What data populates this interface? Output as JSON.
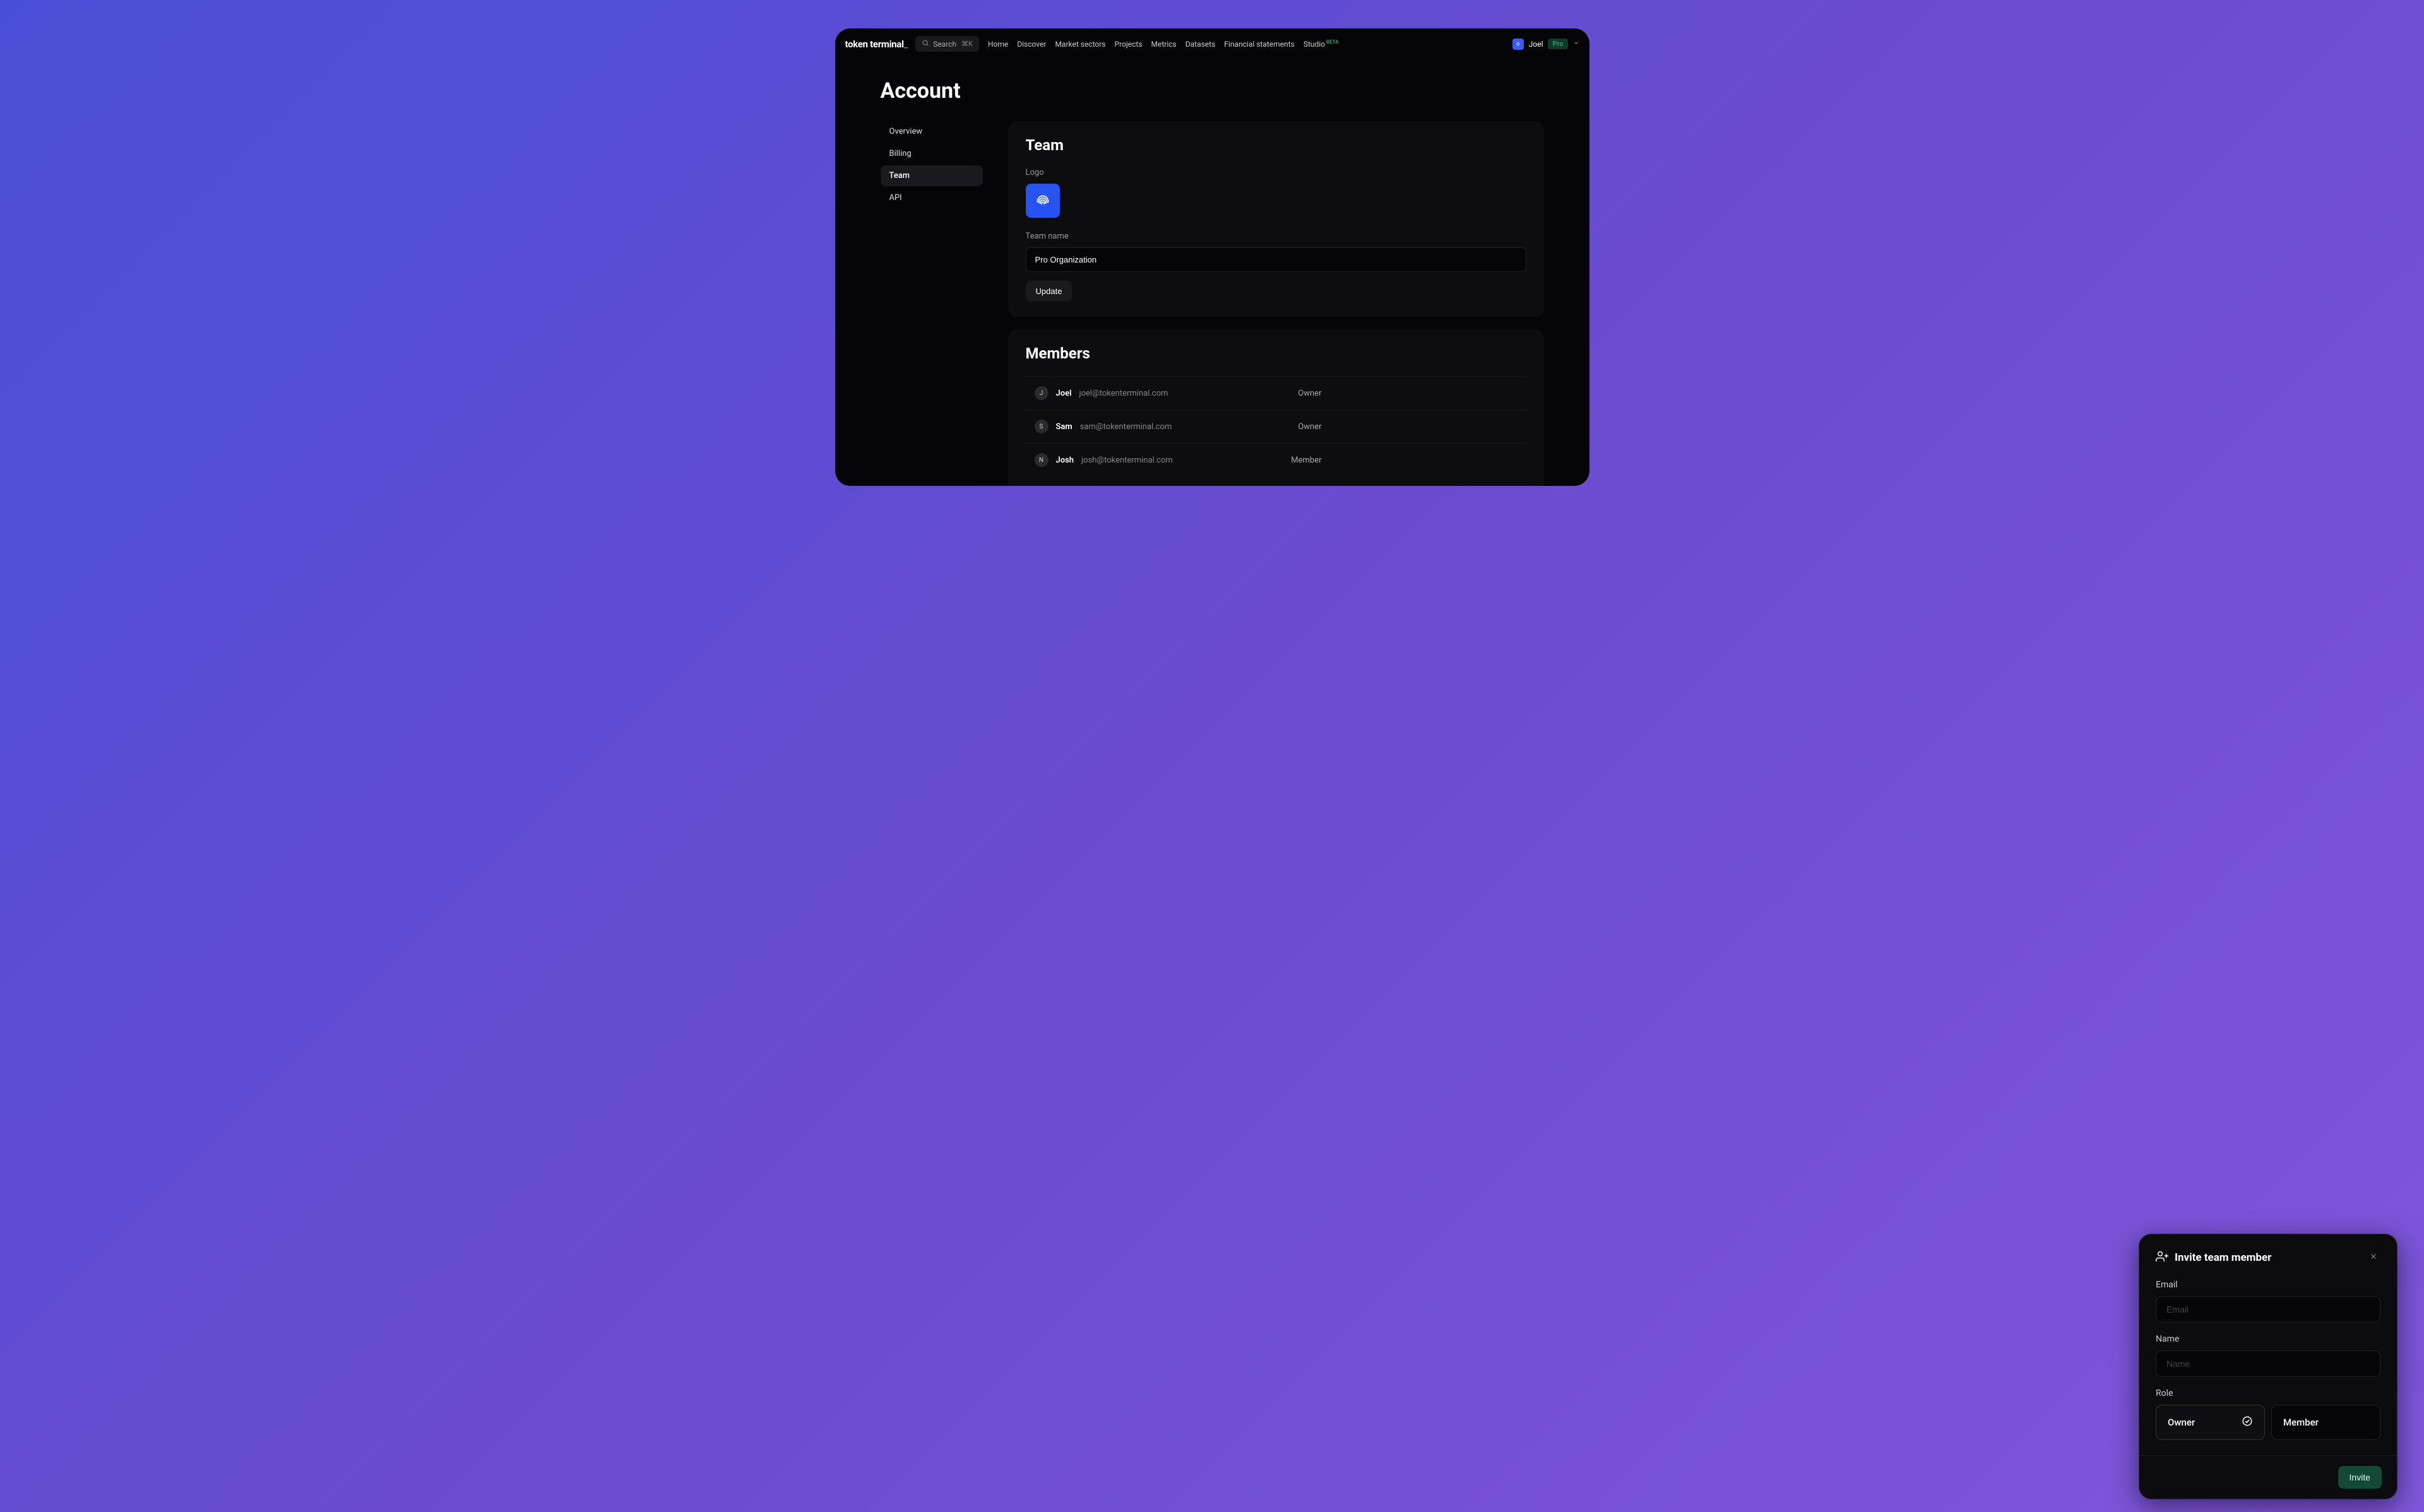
{
  "brand": {
    "name": "token terminal",
    "cursor": "_"
  },
  "search": {
    "placeholder": "Search",
    "shortcut": "⌘K"
  },
  "nav": {
    "items": [
      {
        "label": "Home"
      },
      {
        "label": "Discover"
      },
      {
        "label": "Market sectors"
      },
      {
        "label": "Projects"
      },
      {
        "label": "Metrics"
      },
      {
        "label": "Datasets"
      },
      {
        "label": "Financial statements"
      },
      {
        "label": "Studio",
        "badge": "BETA"
      }
    ]
  },
  "user": {
    "name": "Joel",
    "avatar_letter": "o",
    "plan": "Pro"
  },
  "page": {
    "title": "Account"
  },
  "sidebar": {
    "items": [
      {
        "label": "Overview"
      },
      {
        "label": "Billing"
      },
      {
        "label": "Team"
      },
      {
        "label": "API"
      }
    ]
  },
  "team_card": {
    "title": "Team",
    "logo_label": "Logo",
    "name_label": "Team name",
    "name_value": "Pro Organization",
    "update_label": "Update"
  },
  "members_card": {
    "title": "Members",
    "rows": [
      {
        "initial": "J",
        "name": "Joel",
        "email": "joel@tokenterminal.com",
        "role": "Owner"
      },
      {
        "initial": "S",
        "name": "Sam",
        "email": "sam@tokenterminal.com",
        "role": "Owner"
      },
      {
        "initial": "N",
        "name": "Josh",
        "email": "josh@tokenterminal.com",
        "role": "Member"
      }
    ]
  },
  "invite_modal": {
    "title": "Invite team member",
    "email_label": "Email",
    "email_placeholder": "Email",
    "name_label": "Name",
    "name_placeholder": "Name",
    "role_label": "Role",
    "roles": [
      {
        "label": "Owner",
        "selected": true
      },
      {
        "label": "Member",
        "selected": false
      }
    ],
    "submit_label": "Invite"
  }
}
